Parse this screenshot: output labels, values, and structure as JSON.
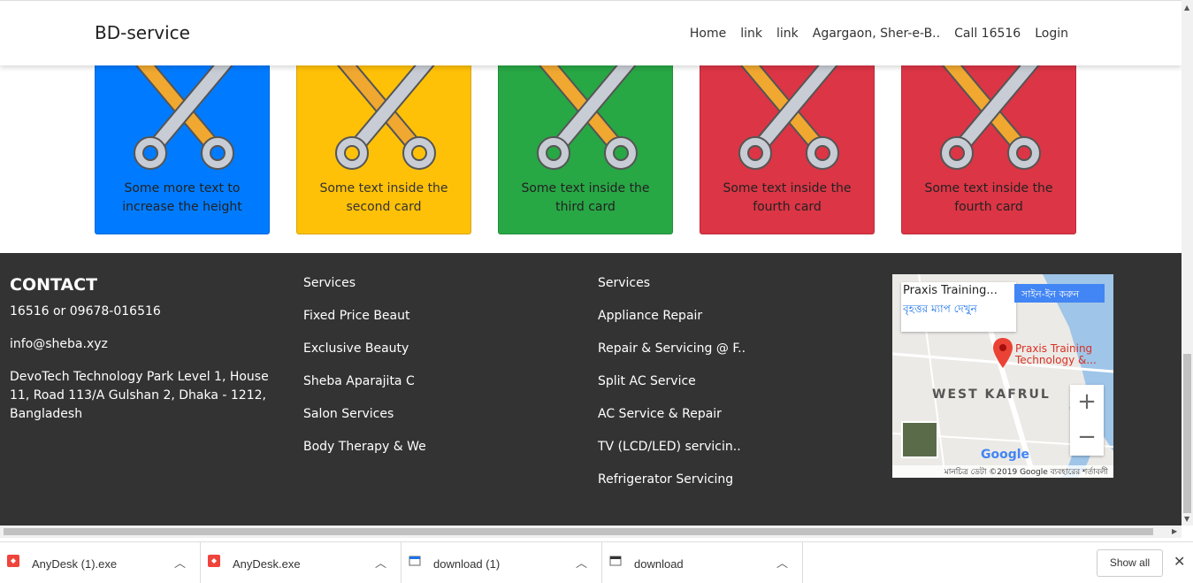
{
  "navbar": {
    "brand": "BD-service",
    "links": [
      "Home",
      "link",
      "link",
      "Agargaon, Sher-e-B..",
      "Call 16516",
      "Login"
    ]
  },
  "cards": [
    {
      "text": "Some more text to increase the height",
      "color": "#007bff"
    },
    {
      "text": "Some text inside the second card",
      "color": "#ffc107"
    },
    {
      "text": "Some text inside the third card",
      "color": "#28a745"
    },
    {
      "text": "Some text inside the fourth card",
      "color": "#dc3545"
    },
    {
      "text": "Some text inside the fourth card",
      "color": "#dc3545"
    }
  ],
  "footer": {
    "contact_title": "CONTACT",
    "phone": "16516 or 09678-016516",
    "email": "info@sheba.xyz",
    "address": "DevoTech Technology Park Level 1, House 11, Road 113/A Gulshan 2, Dhaka - 1212, Bangladesh",
    "col1": [
      "Services",
      "Fixed Price Beaut",
      "Exclusive Beauty",
      "Sheba Aparajita C",
      "Salon Services",
      "Body Therapy & We"
    ],
    "col2": [
      "Services",
      "Appliance Repair",
      "Repair & Servicing @ F..",
      "Split AC Service",
      "AC Service & Repair",
      "TV (LCD/LED) servicin..",
      "Refrigerator Servicing"
    ],
    "background": "#333333"
  },
  "map": {
    "place_title": "Praxis Training...",
    "view_larger": "বৃহত্তর ম্যাপ দেখুন",
    "signin": "সাইন-ইন করুন",
    "marker_label_1": "Praxis Training",
    "marker_label_2": "Technology &...",
    "area_label": "WEST KAFRUL",
    "zoom_in": "+",
    "zoom_out": "−",
    "google": "Google",
    "attribution": "মানচিত্র ডেটা ©2019 Google    ব্যবহারের শর্তাবলী"
  },
  "downloads": [
    {
      "name": "AnyDesk (1).exe",
      "icon": "anydesk-icon"
    },
    {
      "name": "AnyDesk.exe",
      "icon": "anydesk-icon"
    },
    {
      "name": "download (1)",
      "icon": "file-icon"
    },
    {
      "name": "download",
      "icon": "file-icon"
    }
  ],
  "download_bar": {
    "show_all": "Show all",
    "close": "✕"
  }
}
